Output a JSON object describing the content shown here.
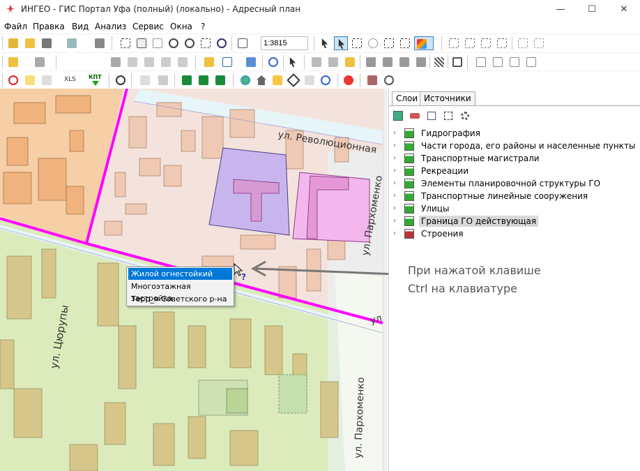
{
  "window": {
    "title": "ИНГЕО - ГИС Портал Уфа (полный) (локально) - Адресный план",
    "minimize": "—",
    "maximize": "☐",
    "close": "✕"
  },
  "menu": [
    "Файл",
    "Правка",
    "Вид",
    "Анализ",
    "Сервис",
    "Окна",
    "?"
  ],
  "toolbar": {
    "scale_value": "1:3815"
  },
  "map": {
    "street_labels": [
      "ул. Революционная",
      "ул. Пархоменко",
      "ул. Цюрупы",
      "ул. Пархоменко",
      "ул"
    ]
  },
  "context_menu": {
    "items": [
      "Жилой огнестойкий",
      "Многоэтажная застройка",
      "Терр_я Советского р-на"
    ],
    "highlighted": 0
  },
  "panel": {
    "tabs": [
      "Слои",
      "Источники"
    ],
    "active_tab": 0,
    "layers": [
      "Гидрография",
      "Части города, его районы и населенные пункты",
      "Транспортные магистрали",
      "Рекреации",
      "Элементы планировочной структуры ГО",
      "Транспортные линейные сооружения",
      "Улицы",
      "Граница ГО действующая",
      "Строения"
    ],
    "selected_layer": 7
  },
  "annotation": {
    "line1": "При нажатой клавише",
    "line2": "Ctrl на клавиатуре"
  },
  "colors": {
    "accent": "#0078d7",
    "boundary": "#ff00ff",
    "selection": "#cce4f7"
  }
}
